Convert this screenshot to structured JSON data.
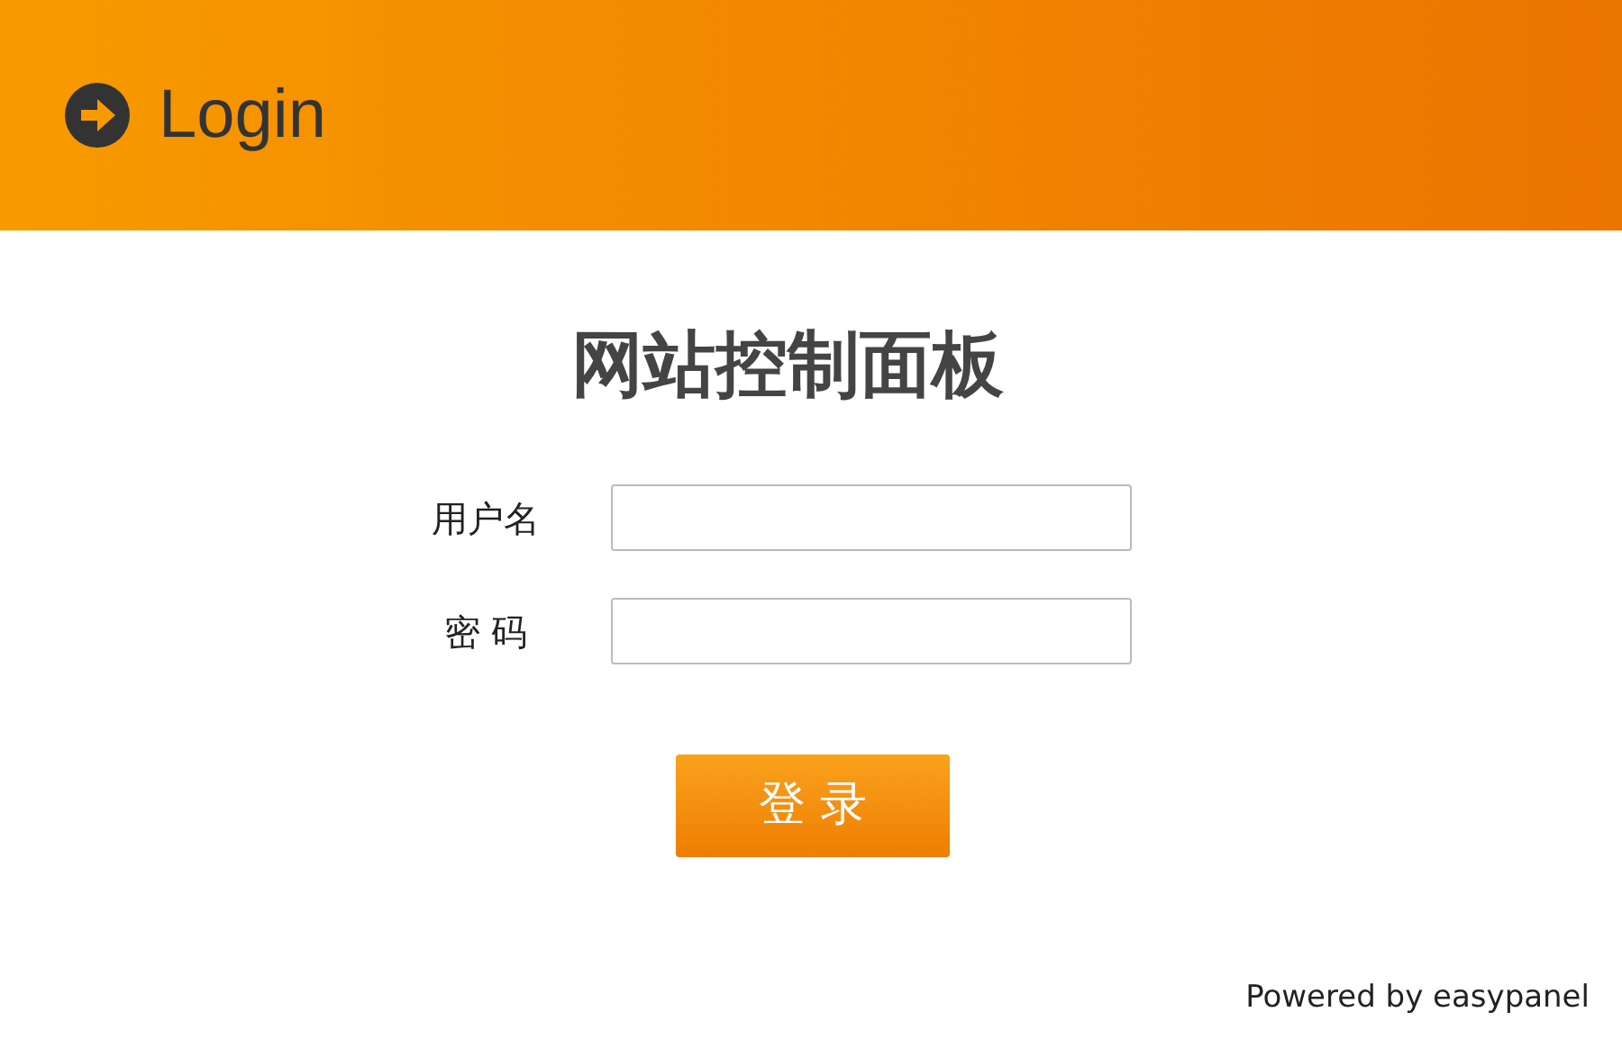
{
  "header": {
    "title": "Login"
  },
  "panel_title": "网站控制面板",
  "fields": [
    {
      "label": "用户名"
    },
    {
      "label": "密 码"
    }
  ],
  "login_button": "登 录",
  "footer": "Powered by easypanel"
}
